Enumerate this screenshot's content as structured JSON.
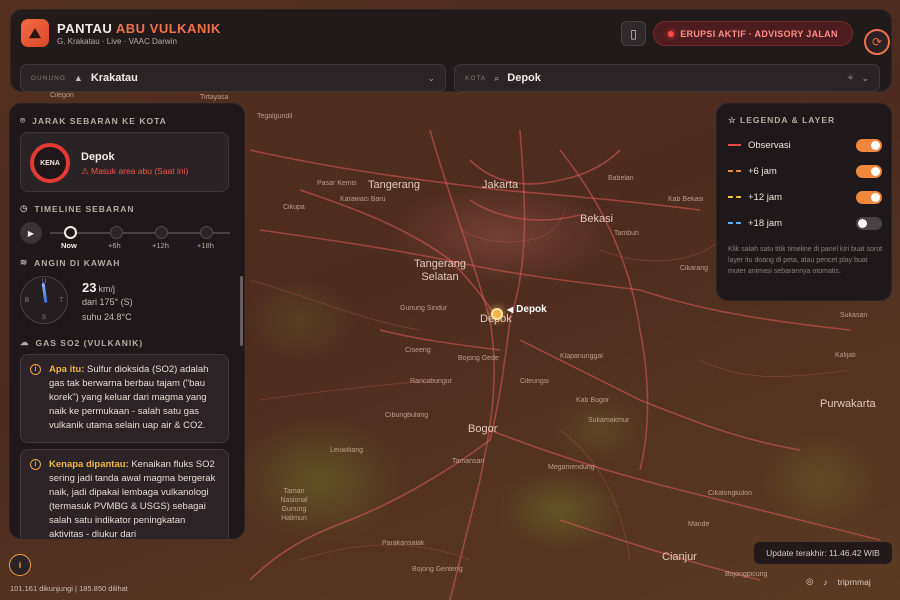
{
  "app": {
    "title_main": "PANTAU",
    "title_accent": "ABU VULKANIK",
    "subtitle": "G. Krakatau · Live · VAAC Darwin",
    "alert_label": "ERUPSI AKTIF · ADVISORY JALAN"
  },
  "selectors": {
    "volcano_label": "GUNUNG",
    "volcano_value": "Krakatau",
    "city_label": "KOTA",
    "city_value": "Depok"
  },
  "panel": {
    "distance_title": "JARAK SEBARAN KE KOTA",
    "badge": "KENA",
    "city_name": "Depok",
    "city_status": "Masuk area abu (Saat ini)",
    "timeline_title": "TIMELINE SEBARAN",
    "timeline": [
      "Now",
      "+6h",
      "+12h",
      "+18h"
    ],
    "wind_title": "ANGIN DI KAWAH",
    "wind_speed": "23",
    "wind_unit": "km/j",
    "wind_dir": "dari 175° (S)",
    "wind_temp": "suhu 24.8°C",
    "compass": {
      "n": "U",
      "e": "T",
      "s": "S",
      "w": "B"
    },
    "so2_title": "GAS SO2 (VULKANIK)",
    "so2_what_label": "Apa itu:",
    "so2_what_text": "Sulfur dioksida (SO2) adalah gas tak berwarna berbau tajam (\"bau korek\") yang keluar dari magma yang naik ke permukaan - salah satu gas vulkanik utama selain uap air & CO2.",
    "so2_why_label": "Kenapa dipantau:",
    "so2_why_text": "Kenaikan fluks SO2 sering jadi tanda awal magma bergerak naik, jadi dipakai lembaga vulkanologi (termasuk PVMBG & USGS) sebagai salah satu indikator peningkatan aktivitas - diukur dari"
  },
  "legend": {
    "title": "LEGENDA & LAYER",
    "rows": [
      {
        "name": "Observasi",
        "color": "#ef4a43",
        "on": true,
        "solid": true
      },
      {
        "name": "+6 jam",
        "color": "#f08a3a",
        "on": true,
        "solid": false
      },
      {
        "name": "+12 jam",
        "color": "#f2c53a",
        "on": true,
        "solid": false
      },
      {
        "name": "+18 jam",
        "color": "#4fb3ff",
        "on": false,
        "solid": false
      }
    ],
    "note": "Klik salah satu titik timeline di panel kiri buat sorot layer itu doang di peta, atau pencet play buat muter animasi sebarannya otomatis."
  },
  "map": {
    "labels": [
      {
        "t": "Jakarta",
        "big": true
      },
      {
        "t": "Bekasi",
        "big": true
      },
      {
        "t": "Tangerang",
        "big": true
      },
      {
        "t": "Tangerang Selatan",
        "big": true
      },
      {
        "t": "Depok",
        "big": true
      },
      {
        "t": "Bogor",
        "big": true
      },
      {
        "t": "Cianjur",
        "big": true
      },
      {
        "t": "Purwakarta",
        "big": true
      },
      {
        "t": "Cilegon"
      },
      {
        "t": "Tirtayasa"
      },
      {
        "t": "Tegalgundil"
      },
      {
        "t": "Pasar Kemis"
      },
      {
        "t": "Karawaci Baru"
      },
      {
        "t": "Cikupa"
      },
      {
        "t": "Babelan"
      },
      {
        "t": "Kab Bekasi"
      },
      {
        "t": "Tambun"
      },
      {
        "t": "Cikarang"
      },
      {
        "t": "Gunung Sindur"
      },
      {
        "t": "Ciseeng"
      },
      {
        "t": "Bojong Gede"
      },
      {
        "t": "Rancabungur"
      },
      {
        "t": "Cileungsi"
      },
      {
        "t": "Klapanunggal"
      },
      {
        "t": "Kab Bogor"
      },
      {
        "t": "Sukamakmur"
      },
      {
        "t": "Megamendung"
      },
      {
        "t": "Tamansari"
      },
      {
        "t": "Cibungbulang"
      },
      {
        "t": "Leuwiliang"
      },
      {
        "t": "Parakansalak"
      },
      {
        "t": "Bojong Genteng"
      },
      {
        "t": "Cikalongkulon"
      },
      {
        "t": "Bojongpicung"
      },
      {
        "t": "Sukasari"
      },
      {
        "t": "Kalijati"
      },
      {
        "t": "Taman Nasional Gunung Halimun"
      },
      {
        "t": "Mande"
      }
    ],
    "pin_label": "Depok"
  },
  "footer": {
    "counter": "101.161 dikunjungi | 185.850 dilihat",
    "updated": "Update terakhir: 11.46.42 WIB",
    "handle": "triprnmaj"
  }
}
